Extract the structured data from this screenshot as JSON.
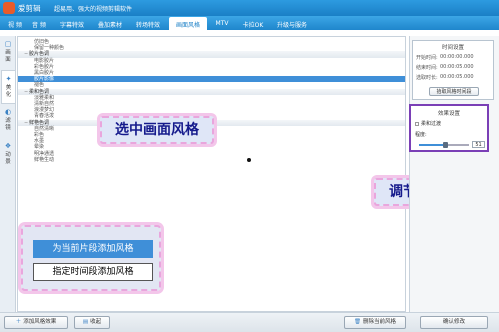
{
  "app": {
    "name": "爱剪辑",
    "slogan": "超易用、强大的视频剪辑软件"
  },
  "menu": {
    "tabs": [
      {
        "label": "视 频"
      },
      {
        "label": "音 频"
      },
      {
        "label": "字幕特效"
      },
      {
        "label": "叠加素材"
      },
      {
        "label": "转场特效"
      },
      {
        "label": "画面风格"
      },
      {
        "label": "MTV"
      },
      {
        "label": "卡拉OK"
      },
      {
        "label": "升级与服务"
      }
    ],
    "active_index": 5
  },
  "side_tabs": [
    {
      "label": "画面",
      "icon": "frame-icon"
    },
    {
      "label": "美化",
      "icon": "sparkle-icon"
    },
    {
      "label": "滤镜",
      "icon": "filter-icon"
    },
    {
      "label": "动景",
      "icon": "scene-icon"
    }
  ],
  "style_list": [
    {
      "type": "item",
      "label": "仿旧色"
    },
    {
      "type": "item",
      "label": "保留一种颜色"
    },
    {
      "type": "category",
      "label": "胶片色调"
    },
    {
      "type": "item",
      "label": "电影胶片"
    },
    {
      "type": "item",
      "label": "彩色胶片"
    },
    {
      "type": "item",
      "label": "黑白胶片"
    },
    {
      "type": "item",
      "label": "胶片影像",
      "selected": true
    },
    {
      "type": "item",
      "label": "褪色"
    },
    {
      "type": "category",
      "label": "柔和色调"
    },
    {
      "type": "item",
      "label": "淡雅柔和"
    },
    {
      "type": "item",
      "label": "清新自然"
    },
    {
      "type": "item",
      "label": "浪漫梦幻"
    },
    {
      "type": "item",
      "label": "青春活泼"
    },
    {
      "type": "category",
      "label": "鲜艳色调"
    },
    {
      "type": "item",
      "label": "自然清晰"
    },
    {
      "type": "item",
      "label": "彩色"
    },
    {
      "type": "item",
      "label": "水墨"
    },
    {
      "type": "item",
      "label": "晕染"
    },
    {
      "type": "item",
      "label": "明净通透"
    },
    {
      "type": "item",
      "label": "鲜艳生动"
    }
  ],
  "callouts": {
    "select_style": "选中画面风格",
    "adjust_degree": "调节程度"
  },
  "popup": {
    "add_current": "为当前片段添加风格",
    "add_range": "指定时间段添加风格"
  },
  "time_settings": {
    "title": "时间设置",
    "start_label": "开始时间:",
    "start_value": "00:00:00.000",
    "end_label": "结束时间:",
    "end_value": "00:00:05.000",
    "duration_label": "选取时长:",
    "duration_value": "00:00:05.000",
    "pick_button": "拾取风格时间段"
  },
  "effect_settings": {
    "title": "效果设置",
    "smooth_label": "柔和过渡",
    "smooth_checked": false,
    "degree_label": "程度:",
    "degree_value": "51",
    "degree_max": 100
  },
  "bottom": {
    "add_style": "添加风格效果",
    "favorite": "收起",
    "delete": "删除当前风格",
    "confirm": "确认修改"
  },
  "colors": {
    "accent": "#1a7fc6",
    "selection": "#3f8fd8",
    "callout_text": "#151a8c",
    "callout_border": "#e9a6dd",
    "effect_border": "#7a3fb6"
  }
}
